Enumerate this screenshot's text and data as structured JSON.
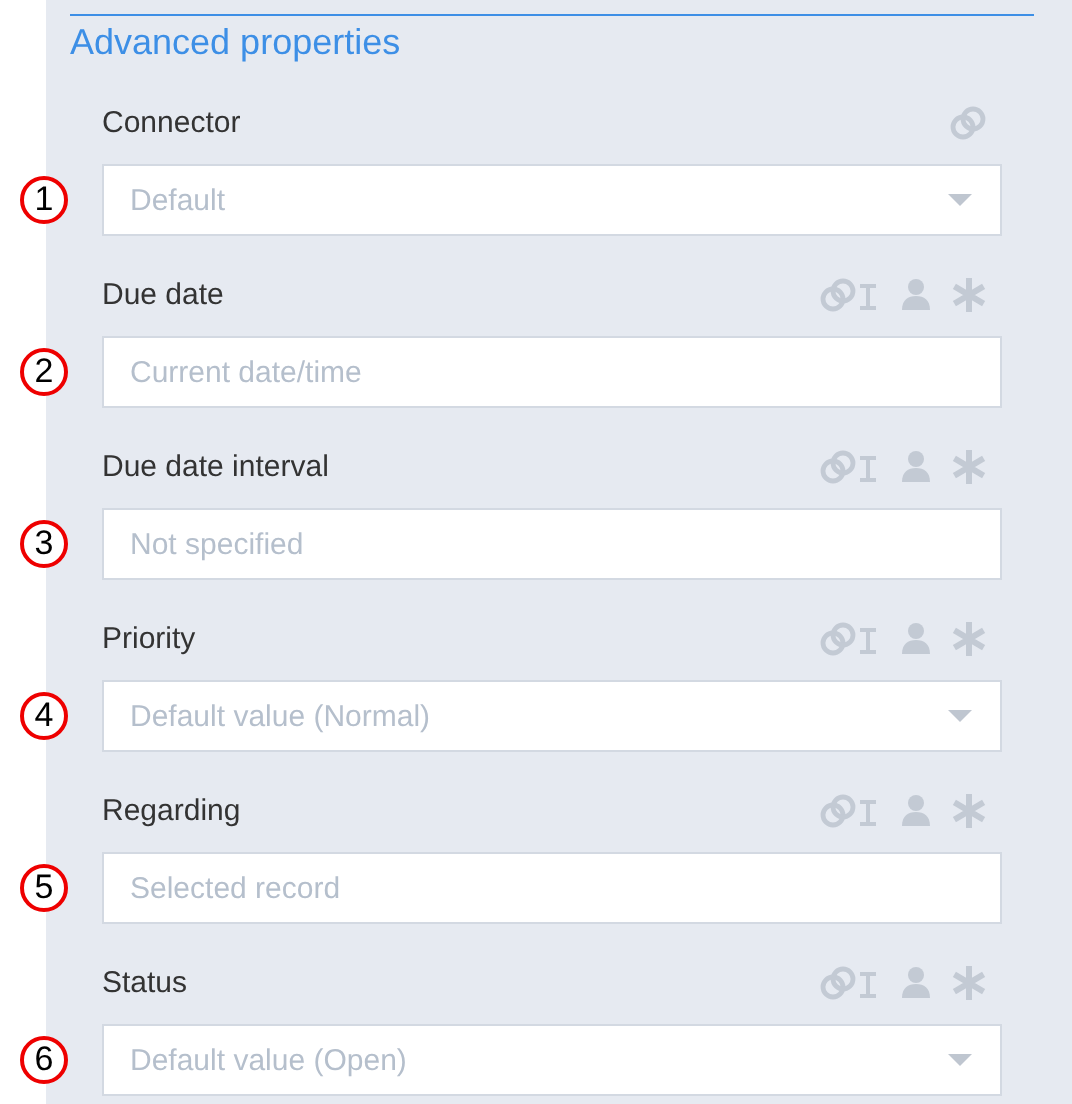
{
  "section_title": "Advanced properties",
  "fields": [
    {
      "badge": "1",
      "label": "Connector",
      "kind": "dropdown",
      "placeholder": "Default",
      "extra_icons": false
    },
    {
      "badge": "2",
      "label": "Due date",
      "kind": "text",
      "placeholder": "Current date/time",
      "extra_icons": true
    },
    {
      "badge": "3",
      "label": "Due date interval",
      "kind": "text",
      "placeholder": "Not specified",
      "extra_icons": true
    },
    {
      "badge": "4",
      "label": "Priority",
      "kind": "dropdown",
      "placeholder": "Default value (Normal)",
      "extra_icons": true
    },
    {
      "badge": "5",
      "label": "Regarding",
      "kind": "text",
      "placeholder": "Selected record",
      "extra_icons": true
    },
    {
      "badge": "6",
      "label": "Status",
      "kind": "dropdown",
      "placeholder": "Default value (Open)",
      "extra_icons": true
    }
  ]
}
